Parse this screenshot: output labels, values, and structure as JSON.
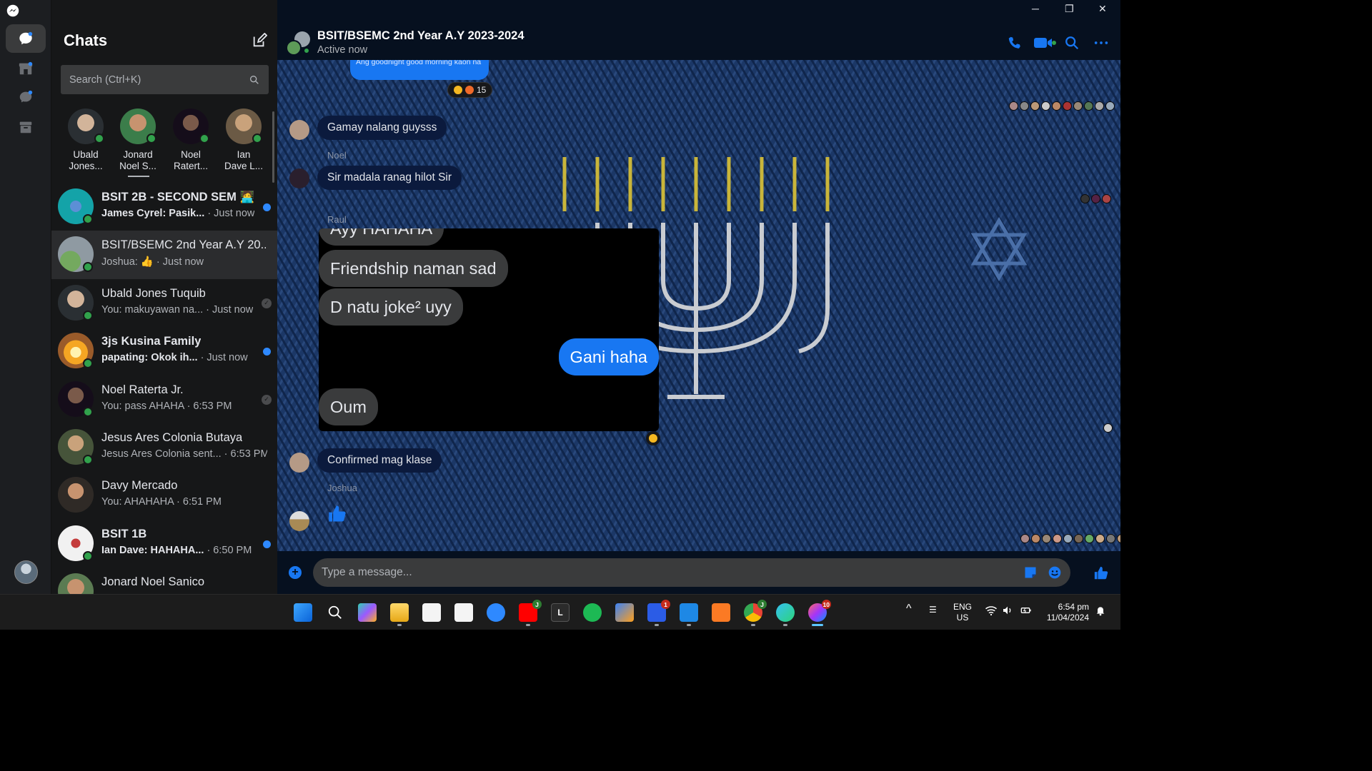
{
  "app": {
    "name": "Messenger"
  },
  "colors": {
    "accent": "#1877f2",
    "online": "#31a24c",
    "unread": "#2e89ff"
  },
  "sidebar": {
    "title": "Chats",
    "search_placeholder": "Search (Ctrl+K)",
    "rail_icons": [
      "messenger-logo-icon",
      "chats-icon",
      "marketplace-icon",
      "message-requests-icon",
      "archive-icon"
    ]
  },
  "stories": [
    {
      "name_line1": "Ubald",
      "name_line2": "Jones..."
    },
    {
      "name_line1": "Jonard",
      "name_line2": "Noel S..."
    },
    {
      "name_line1": "Noel",
      "name_line2": "Ratert..."
    },
    {
      "name_line1": "Ian",
      "name_line2": "Dave L..."
    }
  ],
  "conversations": [
    {
      "title": "BSIT 2B - SECOND SEM 🧑‍💻",
      "sender": "James Cyrel: Pasik...",
      "time": " · Just now",
      "unread": true,
      "bold": true
    },
    {
      "title": "BSIT/BSEMC 2nd Year A.Y 20...",
      "sender": "Joshua: 👍",
      "time": " · Just now",
      "unread": false,
      "active": true
    },
    {
      "title": "Ubald Jones Tuquib",
      "sender": "You: makuyawan na...",
      "time": " · Just now",
      "unread": false,
      "read": true
    },
    {
      "title": "3js Kusina Family",
      "sender": "papating: Okok ih...",
      "time": " · Just now",
      "unread": true,
      "bold": true
    },
    {
      "title": "Noel Raterta Jr.",
      "sender": "You: pass AHAHA",
      "time": " · 6:53 PM",
      "unread": false,
      "read": true
    },
    {
      "title": "Jesus Ares Colonia Butaya",
      "sender": "Jesus Ares Colonia sent...",
      "time": " · 6:53 PM",
      "unread": false
    },
    {
      "title": "Davy Mercado",
      "sender": "You: AHAHAHA",
      "time": " · 6:51 PM",
      "unread": false
    },
    {
      "title": "BSIT 1B",
      "sender": "Ian Dave: HAHAHA...",
      "time": " · 6:50 PM",
      "unread": true,
      "bold": true
    },
    {
      "title": "Jonard Noel Sanico",
      "sender": "",
      "time": "",
      "unread": false
    }
  ],
  "chat": {
    "title": "BSIT/BSEMC 2nd Year A.Y 2023-2024",
    "status": "Active now",
    "top_snippet": "Ang goodnight good morning kaon na",
    "top_reaction_count": "15",
    "messages": [
      {
        "text": "Gamay nalang guysss"
      },
      {
        "sender": "Noel",
        "text": "Sir madala ranag hilot Sir"
      },
      {
        "sender": "Raul"
      },
      {
        "text": "Confirmed mag klase"
      },
      {
        "sender": "Joshua"
      }
    ],
    "screenshot_messages": [
      {
        "text": "Ayy HAHAHA",
        "mine": false
      },
      {
        "text": "Friendship naman sad",
        "mine": false
      },
      {
        "text": "D natu joke² uyy",
        "mine": false
      },
      {
        "text": "Gani haha",
        "mine": true
      },
      {
        "text": "Oum",
        "mine": false
      }
    ],
    "composer_placeholder": "Type a message..."
  },
  "window_controls": {
    "minimize": "─",
    "restore": "❐",
    "close": "✕"
  },
  "taskbar": {
    "apps": [
      "start-icon",
      "search-icon",
      "chatgpt-icon",
      "file-explorer-icon",
      "store-icon",
      "mail-icon",
      "chat-icon",
      "youtube-icon",
      "app-L-icon",
      "spotify-icon",
      "network-icon",
      "word-icon",
      "vscode-icon",
      "xampp-icon",
      "chrome-icon",
      "edge-icon",
      "messenger-icon"
    ],
    "app_letters": {
      "app-L-icon": "L"
    },
    "badges": {
      "youtube-icon": "J",
      "word-icon": "1",
      "chrome-icon": "J",
      "messenger-icon": "10"
    },
    "language_line1": "ENG",
    "language_line2": "US",
    "time": "6:54 pm",
    "date": "11/04/2024"
  }
}
